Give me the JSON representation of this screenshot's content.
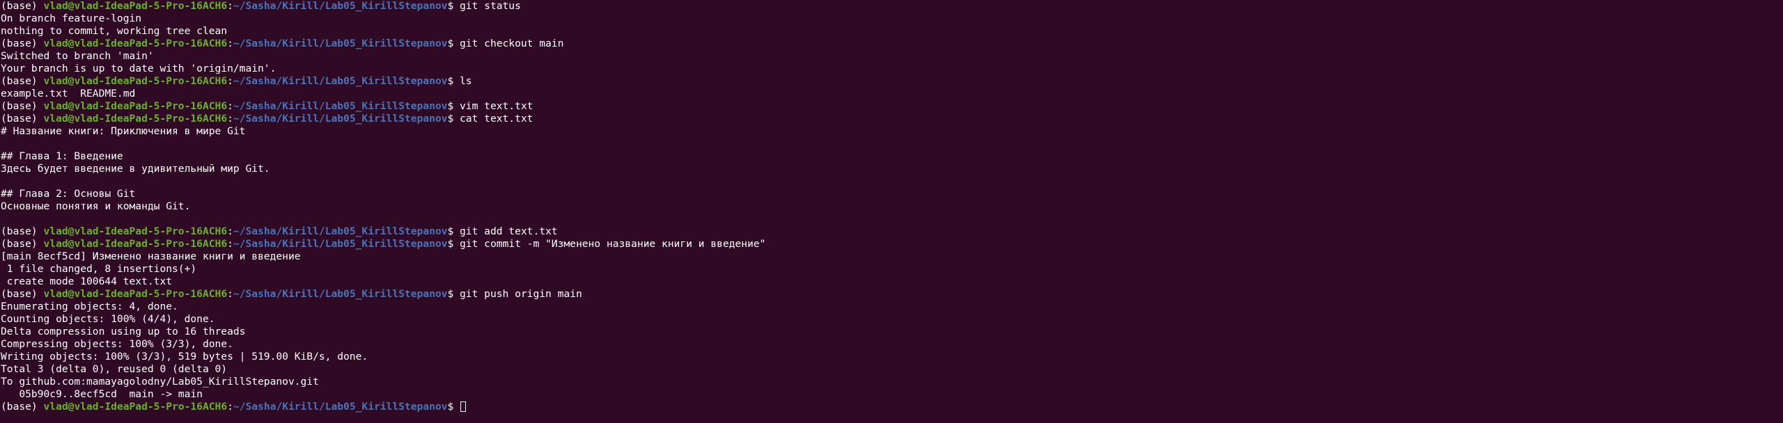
{
  "theme": {
    "background": "#300a24",
    "text": "#ffffff",
    "user_host": "#6ab02a",
    "path": "#4a73b8"
  },
  "prompt": {
    "env": "(base) ",
    "user_host": "vlad@vlad-IdeaPad-5-Pro-16ACH6",
    "colon": ":",
    "path": "~/Sasha/Kirill/Lab05_KirillStepanov",
    "dollar": "$ "
  },
  "lines": [
    {
      "type": "prompt",
      "cmd": "git status"
    },
    {
      "type": "out",
      "text": "On branch feature-login"
    },
    {
      "type": "out",
      "text": "nothing to commit, working tree clean"
    },
    {
      "type": "prompt",
      "cmd": "git checkout main"
    },
    {
      "type": "out",
      "text": "Switched to branch 'main'"
    },
    {
      "type": "out",
      "text": "Your branch is up to date with 'origin/main'."
    },
    {
      "type": "prompt",
      "cmd": "ls"
    },
    {
      "type": "out",
      "text": "example.txt  README.md"
    },
    {
      "type": "prompt",
      "cmd": "vim text.txt"
    },
    {
      "type": "prompt",
      "cmd": "cat text.txt"
    },
    {
      "type": "out",
      "text": "# Название книги: Приключения в мире Git"
    },
    {
      "type": "out",
      "text": ""
    },
    {
      "type": "out",
      "text": "## Глава 1: Введение"
    },
    {
      "type": "out",
      "text": "Здесь будет введение в удивительный мир Git."
    },
    {
      "type": "out",
      "text": ""
    },
    {
      "type": "out",
      "text": "## Глава 2: Основы Git"
    },
    {
      "type": "out",
      "text": "Основные понятия и команды Git."
    },
    {
      "type": "out",
      "text": ""
    },
    {
      "type": "prompt",
      "cmd": "git add text.txt"
    },
    {
      "type": "prompt",
      "cmd": "git commit -m \"Изменено название книги и введение\""
    },
    {
      "type": "out",
      "text": "[main 8ecf5cd] Изменено название книги и введение"
    },
    {
      "type": "out",
      "text": " 1 file changed, 8 insertions(+)"
    },
    {
      "type": "out",
      "text": " create mode 100644 text.txt"
    },
    {
      "type": "prompt",
      "cmd": "git push origin main"
    },
    {
      "type": "out",
      "text": "Enumerating objects: 4, done."
    },
    {
      "type": "out",
      "text": "Counting objects: 100% (4/4), done."
    },
    {
      "type": "out",
      "text": "Delta compression using up to 16 threads"
    },
    {
      "type": "out",
      "text": "Compressing objects: 100% (3/3), done."
    },
    {
      "type": "out",
      "text": "Writing objects: 100% (3/3), 519 bytes | 519.00 KiB/s, done."
    },
    {
      "type": "out",
      "text": "Total 3 (delta 0), reused 0 (delta 0)"
    },
    {
      "type": "out",
      "text": "To github.com:mamayagolodny/Lab05_KirillStepanov.git"
    },
    {
      "type": "out",
      "text": "   05b90c9..8ecf5cd  main -> main"
    },
    {
      "type": "prompt",
      "cmd": "",
      "cursor": true
    }
  ]
}
